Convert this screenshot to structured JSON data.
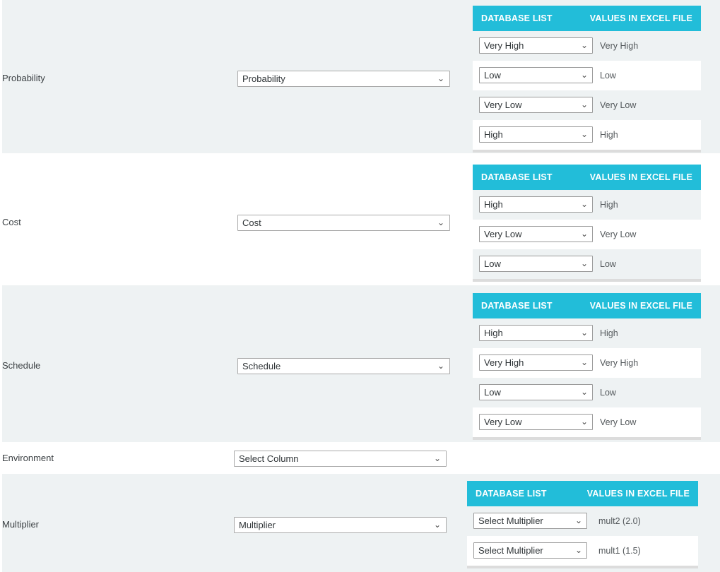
{
  "panel_headers": {
    "database_list": "DATABASE LIST",
    "values_in_excel_file": "VALUES IN EXCEL FILE"
  },
  "colors": {
    "header_cyan": "#22bdd9",
    "row_shaded": "#eef2f3",
    "row_plain": "#ffffff",
    "text": "#3b4043"
  },
  "icons": {
    "caret": "chevron-down-icon"
  },
  "caret_glyph": "⌄",
  "sections": [
    {
      "label": "Probability",
      "column_select": {
        "value": "Probability",
        "placeholder": "Select Column"
      },
      "mappings": [
        {
          "database_list": "Very High",
          "excel_value": "Very High"
        },
        {
          "database_list": "Low",
          "excel_value": "Low"
        },
        {
          "database_list": "Very Low",
          "excel_value": "Very Low"
        },
        {
          "database_list": "High",
          "excel_value": "High"
        }
      ]
    },
    {
      "label": "Cost",
      "column_select": {
        "value": "Cost",
        "placeholder": "Select Column"
      },
      "mappings": [
        {
          "database_list": "High",
          "excel_value": "High"
        },
        {
          "database_list": "Very Low",
          "excel_value": "Very Low"
        },
        {
          "database_list": "Low",
          "excel_value": "Low"
        }
      ]
    },
    {
      "label": "Schedule",
      "column_select": {
        "value": "Schedule",
        "placeholder": "Select Column"
      },
      "mappings": [
        {
          "database_list": "High",
          "excel_value": "High"
        },
        {
          "database_list": "Very High",
          "excel_value": "Very High"
        },
        {
          "database_list": "Low",
          "excel_value": "Low"
        },
        {
          "database_list": "Very Low",
          "excel_value": "Very Low"
        }
      ]
    },
    {
      "label": "Environment",
      "column_select": {
        "value": "Select Column",
        "placeholder": "Select Column"
      },
      "mappings": []
    },
    {
      "label": "Multiplier",
      "column_select": {
        "value": "Multiplier",
        "placeholder": "Select Column"
      },
      "mappings": [
        {
          "database_list": "Select Multiplier",
          "excel_value": "mult2 (2.0)"
        },
        {
          "database_list": "Select Multiplier",
          "excel_value": "mult1 (1.5)"
        }
      ]
    }
  ]
}
